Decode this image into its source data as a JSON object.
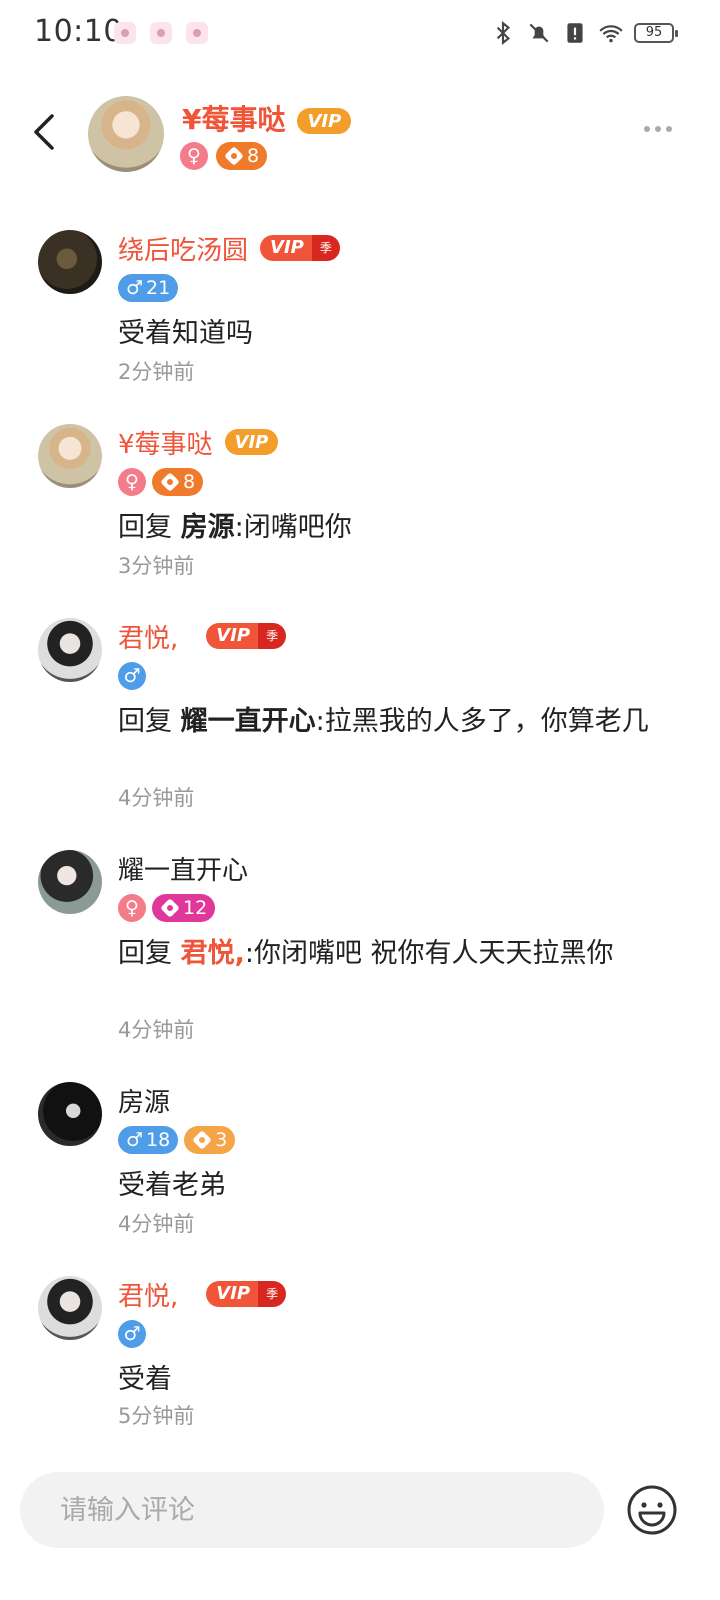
{
  "status_bar": {
    "time": "10:10",
    "battery": "95"
  },
  "header": {
    "name": "¥莓事哒",
    "vip_label": "VIP",
    "gender_symbol": "♀",
    "level": "8"
  },
  "comments": [
    {
      "name": "绕后吃汤圆",
      "vip_label": "VIP",
      "season_label": "季",
      "gender_level": "21",
      "gender_symbol": "♂",
      "text": "受着知道吗",
      "time": "2分钟前"
    },
    {
      "name": "¥莓事哒",
      "vip_label": "VIP",
      "gender_symbol": "♀",
      "level": "8",
      "reply_prefix": "回复",
      "reply_to": "房源",
      "text": ":闭嘴吧你",
      "time": "3分钟前"
    },
    {
      "name": "君悦,",
      "vip_label": "VIP",
      "season_label": "季",
      "gender_symbol": "♂",
      "reply_prefix": "回复",
      "reply_to": "耀一直开心",
      "text": ":拉黑我的人多了，你算老几",
      "time": "4分钟前"
    },
    {
      "name": "耀一直开心",
      "gender_symbol": "♀",
      "level": "12",
      "reply_prefix": "回复",
      "reply_to": "君悦,",
      "text": ":你闭嘴吧 祝你有人天天拉黑你",
      "time": "4分钟前"
    },
    {
      "name": "房源",
      "gender_symbol": "♂",
      "gender_level": "18",
      "level": "3",
      "text": "受着老弟",
      "time": "4分钟前"
    },
    {
      "name": "君悦,",
      "vip_label": "VIP",
      "season_label": "季",
      "gender_symbol": "♂",
      "text": "受着",
      "time": "5分钟前"
    }
  ],
  "input": {
    "placeholder": "请输入评论"
  },
  "colors": {
    "vip_name": "#f0553a",
    "vip_badge": "#f39d2b",
    "female": "#f47b8a",
    "male": "#4f9de8",
    "time_text": "#999999"
  }
}
